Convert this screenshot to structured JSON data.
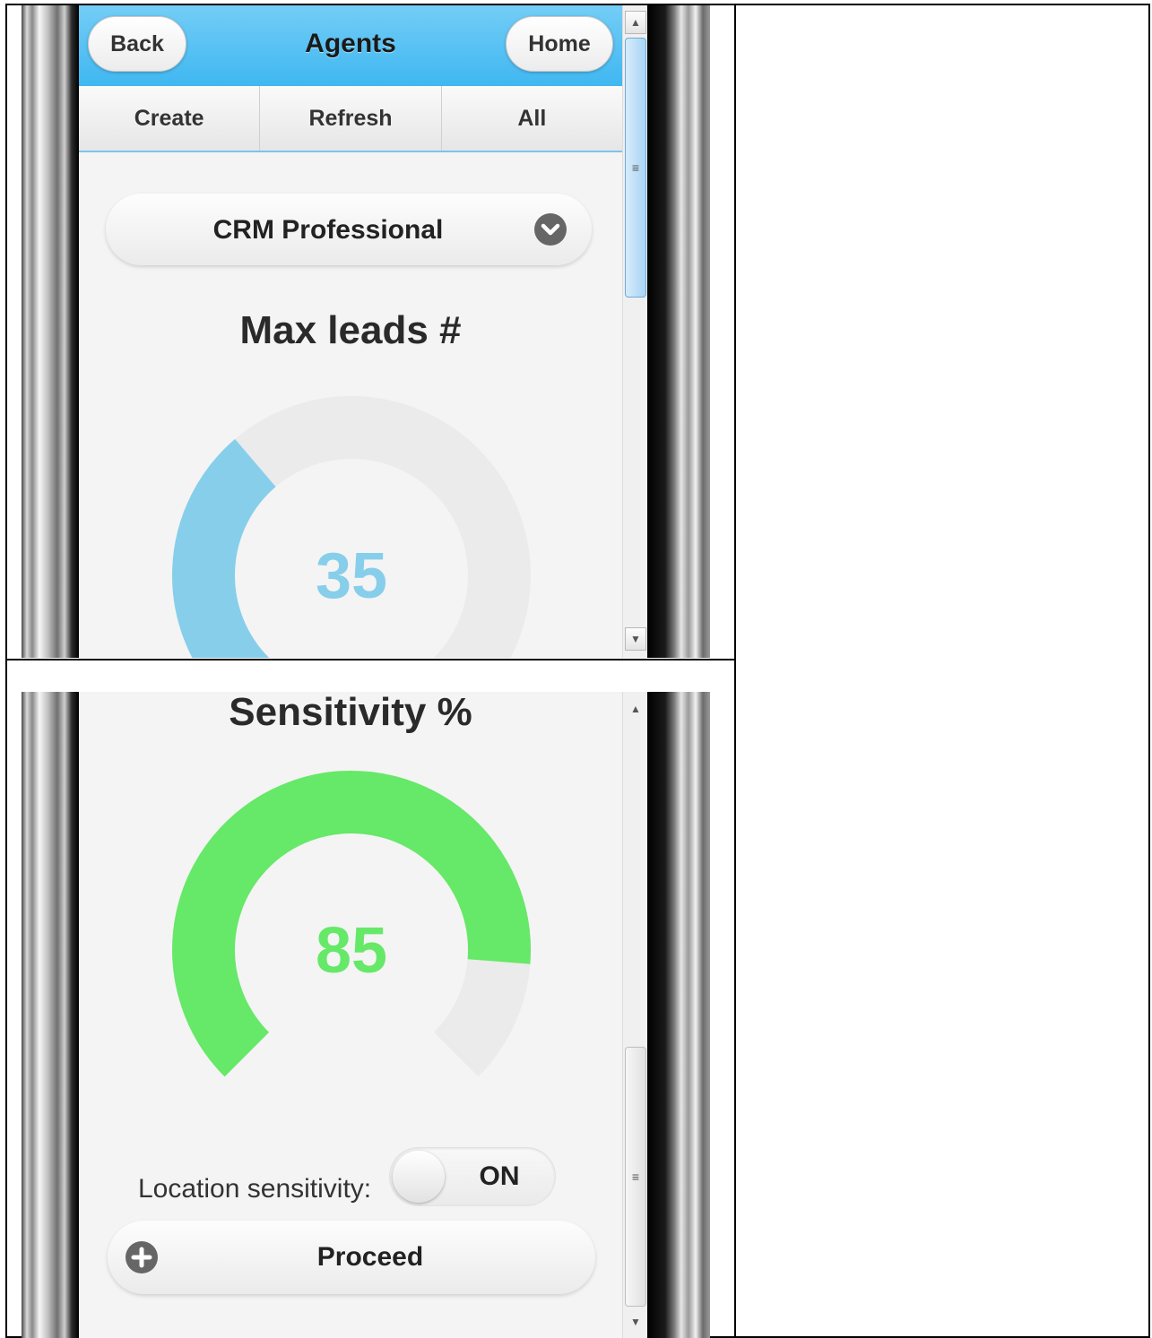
{
  "header": {
    "back_label": "Back",
    "title": "Agents",
    "home_label": "Home"
  },
  "navbar": {
    "items": [
      "Create",
      "Refresh",
      "All"
    ]
  },
  "product_select": {
    "value": "CRM Professional"
  },
  "max_leads": {
    "title": "Max leads #",
    "value": "35",
    "fraction": 0.35,
    "color": "#87ceeb"
  },
  "sensitivity": {
    "title": "Sensitivity %",
    "value": "85",
    "fraction": 0.85,
    "color": "#66e868"
  },
  "location_toggle": {
    "label": "Location sensitivity:",
    "state": "ON"
  },
  "proceed": {
    "label": "Proceed"
  },
  "colors": {
    "header_blue": "#3fb7f1",
    "gauge_track": "#ebebeb"
  },
  "icons": {
    "select_arrow": "chevron-down-circle-icon",
    "proceed": "plus-circle-icon"
  }
}
